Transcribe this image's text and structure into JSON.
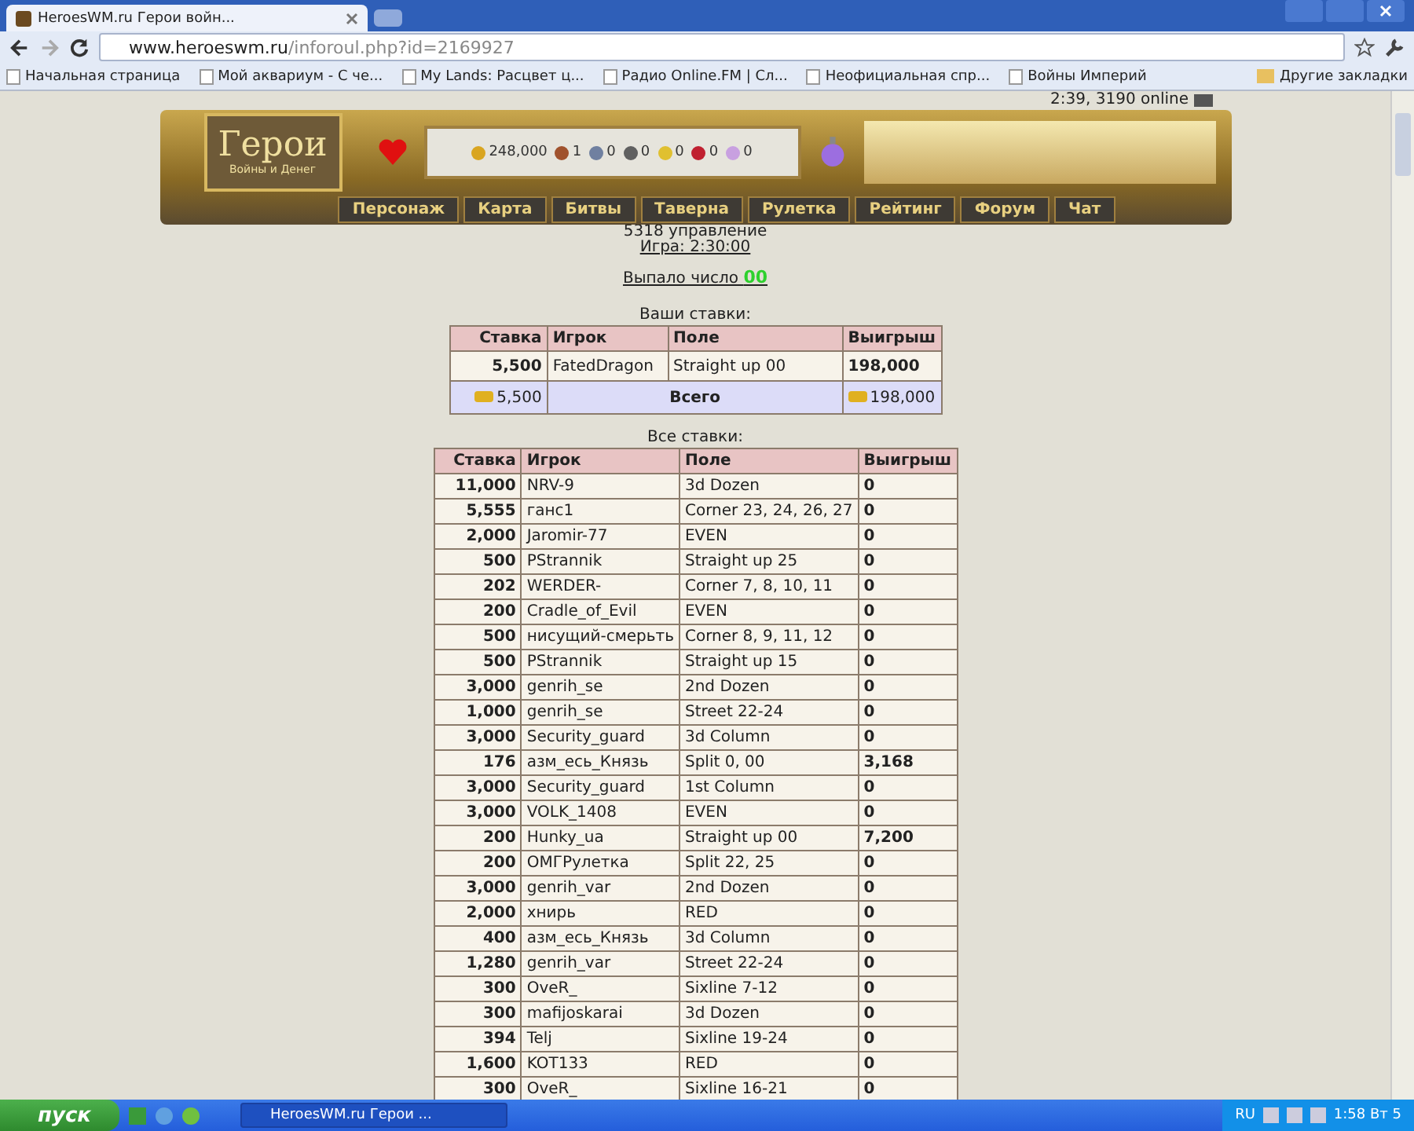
{
  "browser": {
    "tab_title": "HeroesWM.ru Герои войн...",
    "url_host": "www.heroeswm.ru",
    "url_path": "/inforoul.php?id=2169927",
    "bookmarks": [
      "Начальная страница",
      "Мой аквариум - С че...",
      "My Lands: Расцвет ц...",
      "Радио Online.FM | Сл...",
      "Неофициальная спр...",
      "Войны Империй"
    ],
    "other_bookmarks": "Другие закладки"
  },
  "header": {
    "logo_title": "Герои",
    "logo_subtitle": "Войны и Денег",
    "resources": [
      "248,000",
      "1",
      "0",
      "0",
      "0",
      "0",
      "0"
    ],
    "online": "2:39, 3190 online",
    "nav": [
      "Персонаж",
      "Карта",
      "Битвы",
      "Таверна",
      "Рулетка",
      "Рейтинг",
      "Форум",
      "Чат"
    ]
  },
  "game": {
    "info": "5318 управление",
    "game_link": "Игра: 2:30:00",
    "result_label": "Выпало число",
    "result_number": "00"
  },
  "your_bets": {
    "caption": "Ваши ставки:",
    "columns": [
      "Ставка",
      "Игрок",
      "Поле",
      "Выигрыш"
    ],
    "rows": [
      {
        "stake": "5,500",
        "player": "FatedDragon",
        "field": "Straight up 00",
        "win": "198,000"
      }
    ],
    "total": {
      "stake": "5,500",
      "label": "Всего",
      "win": "198,000"
    }
  },
  "all_bets": {
    "caption": "Все ставки:",
    "columns": [
      "Ставка",
      "Игрок",
      "Поле",
      "Выигрыш"
    ],
    "rows": [
      {
        "stake": "11,000",
        "player": "NRV-9",
        "field": "3d Dozen",
        "win": "0"
      },
      {
        "stake": "5,555",
        "player": "ганс1",
        "field": "Corner 23, 24, 26, 27",
        "win": "0"
      },
      {
        "stake": "2,000",
        "player": "Jaromir-77",
        "field": "EVEN",
        "win": "0"
      },
      {
        "stake": "500",
        "player": "PStrannik",
        "field": "Straight up 25",
        "win": "0"
      },
      {
        "stake": "202",
        "player": "WERDER-",
        "field": "Corner 7, 8, 10, 11",
        "win": "0"
      },
      {
        "stake": "200",
        "player": "Cradle_of_Evil",
        "field": "EVEN",
        "win": "0"
      },
      {
        "stake": "500",
        "player": "нисущий-смерьть",
        "field": "Corner 8, 9, 11, 12",
        "win": "0"
      },
      {
        "stake": "500",
        "player": "PStrannik",
        "field": "Straight up 15",
        "win": "0"
      },
      {
        "stake": "3,000",
        "player": "genrih_se",
        "field": "2nd Dozen",
        "win": "0"
      },
      {
        "stake": "1,000",
        "player": "genrih_se",
        "field": "Street 22-24",
        "win": "0"
      },
      {
        "stake": "3,000",
        "player": "Security_guard",
        "field": "3d Column",
        "win": "0"
      },
      {
        "stake": "176",
        "player": "азм_есь_Князь",
        "field": "Split 0, 00",
        "win": "3,168"
      },
      {
        "stake": "3,000",
        "player": "Security_guard",
        "field": "1st Column",
        "win": "0"
      },
      {
        "stake": "3,000",
        "player": "VOLK_1408",
        "field": "EVEN",
        "win": "0"
      },
      {
        "stake": "200",
        "player": "Hunky_ua",
        "field": "Straight up 00",
        "win": "7,200"
      },
      {
        "stake": "200",
        "player": "ОМГРулетка",
        "field": "Split 22, 25",
        "win": "0"
      },
      {
        "stake": "3,000",
        "player": "genrih_var",
        "field": "2nd Dozen",
        "win": "0"
      },
      {
        "stake": "2,000",
        "player": "хнирь",
        "field": "RED",
        "win": "0"
      },
      {
        "stake": "400",
        "player": "азм_есь_Князь",
        "field": "3d Column",
        "win": "0"
      },
      {
        "stake": "1,280",
        "player": "genrih_var",
        "field": "Street 22-24",
        "win": "0"
      },
      {
        "stake": "300",
        "player": "OveR_",
        "field": "Sixline 7-12",
        "win": "0"
      },
      {
        "stake": "300",
        "player": "mafijoskarai",
        "field": "3d Dozen",
        "win": "0"
      },
      {
        "stake": "394",
        "player": "Telj",
        "field": "Sixline 19-24",
        "win": "0"
      },
      {
        "stake": "1,600",
        "player": "KOT133",
        "field": "RED",
        "win": "0"
      },
      {
        "stake": "300",
        "player": "OveR_",
        "field": "Sixline 16-21",
        "win": "0"
      }
    ]
  },
  "taskbar": {
    "start": "пуск",
    "window_title": "HeroesWM.ru Герои ...",
    "lang": "RU",
    "clock": "1:58 Вт 5"
  }
}
